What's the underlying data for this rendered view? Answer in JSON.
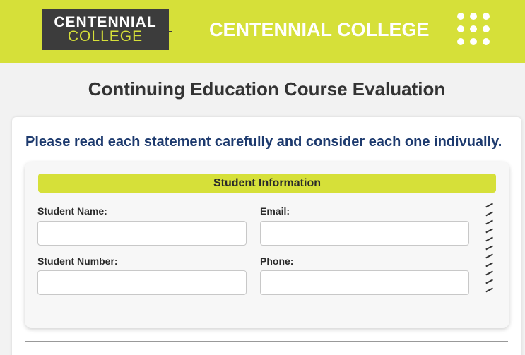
{
  "header": {
    "logo_line1": "CENTENNIAL",
    "logo_line2": "COLLEGE",
    "brand_title": "CENTENNIAL COLLEGE",
    "menu_icon": "grid-dots-icon",
    "accent_color": "#d6e039",
    "logo_bg_color": "#3c3c3c"
  },
  "page": {
    "title": "Continuing Education Course Evaluation"
  },
  "form": {
    "instructions": "Please read each statement carefully and consider each one indivually.",
    "section_title": "Student Information",
    "fields": {
      "student_name": {
        "label": "Student Name:",
        "value": "",
        "placeholder": ""
      },
      "email": {
        "label": "Email:",
        "value": "",
        "placeholder": ""
      },
      "student_number": {
        "label": "Student Number:",
        "value": "",
        "placeholder": ""
      },
      "phone": {
        "label": "Phone:",
        "value": "",
        "placeholder": ""
      }
    }
  }
}
